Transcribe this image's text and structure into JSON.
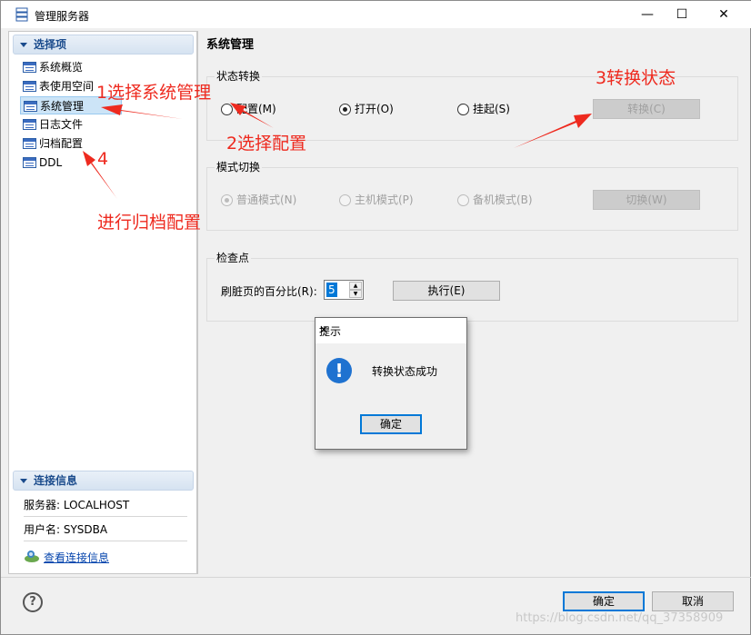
{
  "window": {
    "title": "管理服务器",
    "controls": [
      "—",
      "☐",
      "✕"
    ]
  },
  "sidebar": {
    "options_header": "选择项",
    "items": [
      {
        "label": "系统概览"
      },
      {
        "label": "表使用空间"
      },
      {
        "label": "系统管理",
        "selected": true
      },
      {
        "label": "日志文件"
      },
      {
        "label": "归档配置"
      },
      {
        "label": "DDL"
      }
    ],
    "conn_header": "连接信息",
    "server": "服务器: LOCALHOST",
    "user": "用户名: SYSDBA",
    "view_conn_link": "查看连接信息"
  },
  "main": {
    "title": "系统管理",
    "state_group": {
      "label": "状态转换",
      "radios": [
        {
          "label": "配置(M)",
          "checked": false
        },
        {
          "label": "打开(O)",
          "checked": true
        },
        {
          "label": "挂起(S)",
          "checked": false
        }
      ],
      "button": "转换(C)"
    },
    "mode_group": {
      "label": "模式切换",
      "radios": [
        {
          "label": "普通模式(N)",
          "checked": true
        },
        {
          "label": "主机模式(P)",
          "checked": false
        },
        {
          "label": "备机模式(B)",
          "checked": false
        }
      ],
      "button": "切换(W)"
    },
    "checkpoint_group": {
      "label": "检查点",
      "field_label": "刷脏页的百分比(R):",
      "field_value": "5",
      "button": "执行(E)"
    }
  },
  "dialog": {
    "title": "提示",
    "message": "转换状态成功",
    "ok": "确定"
  },
  "footer": {
    "ok": "确定",
    "cancel": "取消"
  },
  "annotations": {
    "a1": "1选择系统管理",
    "a2": "2选择配置",
    "a3": "3转换状态",
    "a4": "4",
    "a4_text": "进行归档配置"
  },
  "watermark": "https://blog.csdn.net/qq_37358909",
  "colors": {
    "annotation": "#ee2a1f",
    "accent": "#0078d7"
  }
}
